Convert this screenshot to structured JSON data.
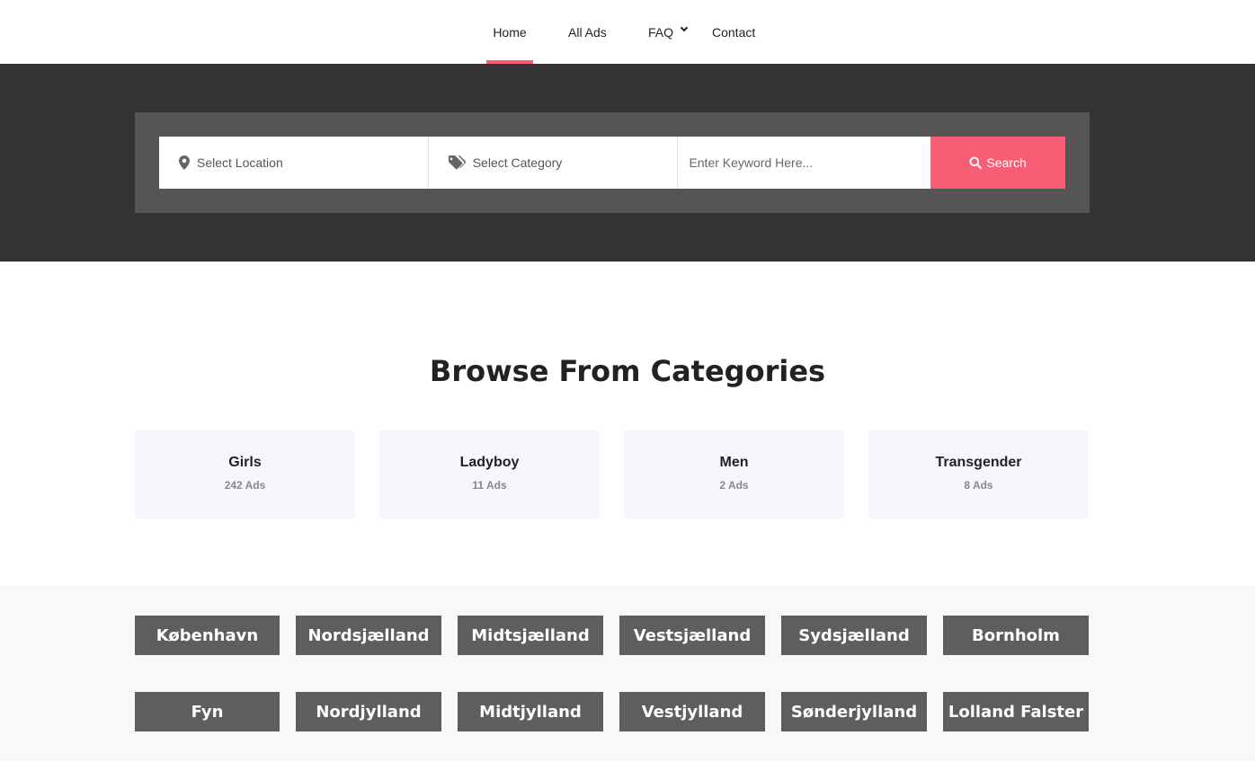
{
  "nav": {
    "items": [
      {
        "label": "Home",
        "active": true
      },
      {
        "label": "All Ads"
      },
      {
        "label": "FAQ"
      },
      {
        "label": "Contact"
      }
    ]
  },
  "search": {
    "location_label": "Select Location",
    "category_label": "Select Category",
    "keyword_placeholder": "Enter Keyword Here...",
    "button_label": "Search"
  },
  "browse": {
    "title": "Browse From Categories",
    "categories": [
      {
        "name": "Girls",
        "count": "242 Ads"
      },
      {
        "name": "Ladyboy",
        "count": "11 Ads"
      },
      {
        "name": "Men",
        "count": "2 Ads"
      },
      {
        "name": "Transgender",
        "count": "8 Ads"
      }
    ]
  },
  "regions": {
    "row1": [
      "København",
      "Nordsjælland",
      "Midtsjælland",
      "Vestsjælland",
      "Sydsjælland",
      "Bornholm"
    ],
    "row2": [
      "Fyn",
      "Nordjylland",
      "Midtjylland",
      "Vestjylland",
      "Sønderjylland",
      "Lolland Falster"
    ]
  },
  "colors": {
    "accent": "#f75d74",
    "hero_bg": "#333333",
    "search_frame": "#555555",
    "region_button": "#5e5e5e",
    "card_bg": "#f4f6fa"
  },
  "icons": {
    "location": "map-marker-icon",
    "category": "tags-icon",
    "search": "search-icon",
    "faq_dropdown": "chevron-down-icon"
  }
}
